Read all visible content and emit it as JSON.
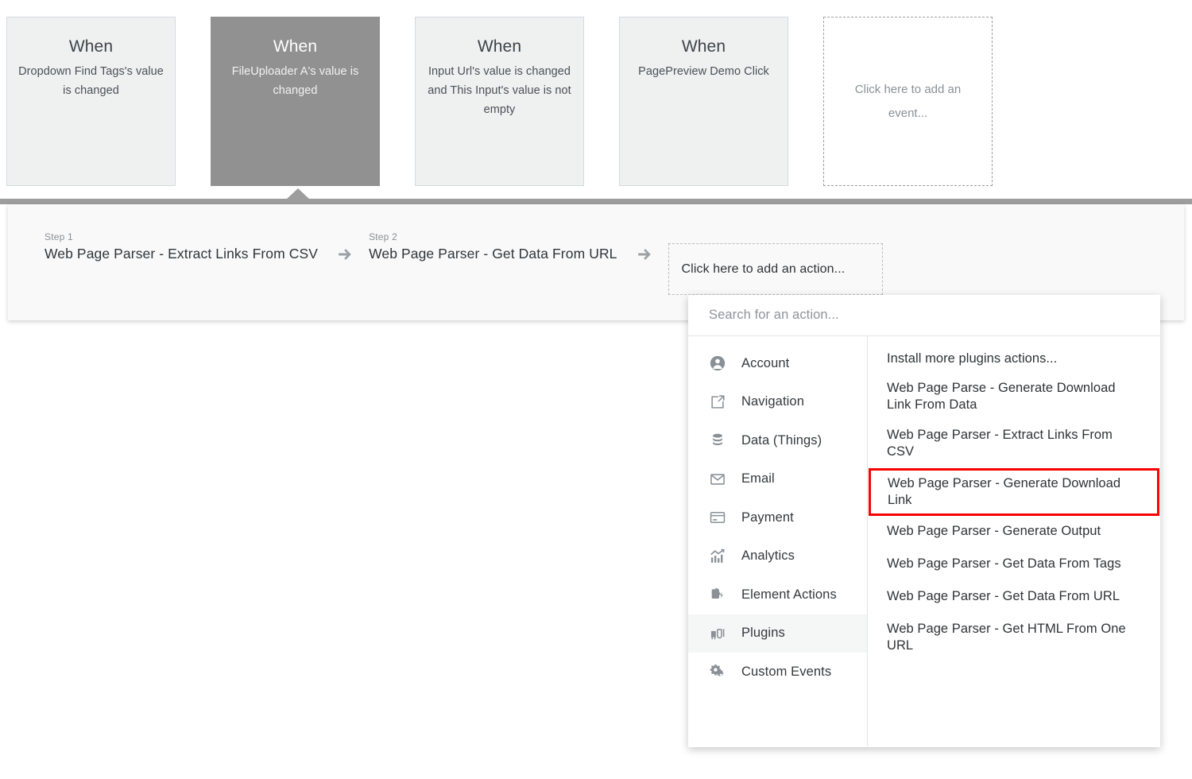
{
  "events": {
    "cards": [
      {
        "title": "When",
        "description": "Dropdown Find Tags's value is changed",
        "state": "normal"
      },
      {
        "title": "When",
        "description": "FileUploader A's value is changed",
        "state": "selected"
      },
      {
        "title": "When",
        "description": "Input Url's value is changed and This Input's value is not empty",
        "state": "normal"
      },
      {
        "title": "When",
        "description": "PagePreview Demo Click",
        "state": "normal"
      }
    ],
    "add_placeholder": "Click here to add an event..."
  },
  "workflow": {
    "steps": [
      {
        "label": "Step 1",
        "title": "Web Page Parser - Extract Links From CSV"
      },
      {
        "label": "Step 2",
        "title": "Web Page Parser - Get Data From URL"
      }
    ],
    "add_action_placeholder": "Click here to add an action...",
    "arrow_icon": "arrow-right-icon"
  },
  "action_picker": {
    "search_placeholder": "Search for an action...",
    "search_value": "",
    "categories": [
      {
        "label": "Account",
        "icon": "account-icon",
        "active": false
      },
      {
        "label": "Navigation",
        "icon": "navigation-icon",
        "active": false
      },
      {
        "label": "Data (Things)",
        "icon": "database-icon",
        "active": false
      },
      {
        "label": "Email",
        "icon": "email-icon",
        "active": false
      },
      {
        "label": "Payment",
        "icon": "payment-card-icon",
        "active": false
      },
      {
        "label": "Analytics",
        "icon": "analytics-chart-icon",
        "active": false
      },
      {
        "label": "Element Actions",
        "icon": "element-actions-icon",
        "active": false
      },
      {
        "label": "Plugins",
        "icon": "plugins-icon",
        "active": true
      },
      {
        "label": "Custom Events",
        "icon": "custom-events-icon",
        "active": false
      }
    ],
    "actions": [
      {
        "label": "Install more plugins actions...",
        "highlighted": false
      },
      {
        "label": "Web Page Parse - Generate Download Link From Data",
        "highlighted": false
      },
      {
        "label": "Web Page Parser - Extract Links From CSV",
        "highlighted": false
      },
      {
        "label": "Web Page Parser - Generate Download Link",
        "highlighted": true
      },
      {
        "label": "Web Page Parser - Generate Output",
        "highlighted": false
      },
      {
        "label": "Web Page Parser - Get Data From Tags",
        "highlighted": false
      },
      {
        "label": "Web Page Parser - Get Data From URL",
        "highlighted": false
      },
      {
        "label": "Web Page Parser - Get HTML From One URL",
        "highlighted": false
      }
    ],
    "highlight_color": "#fa0202"
  }
}
